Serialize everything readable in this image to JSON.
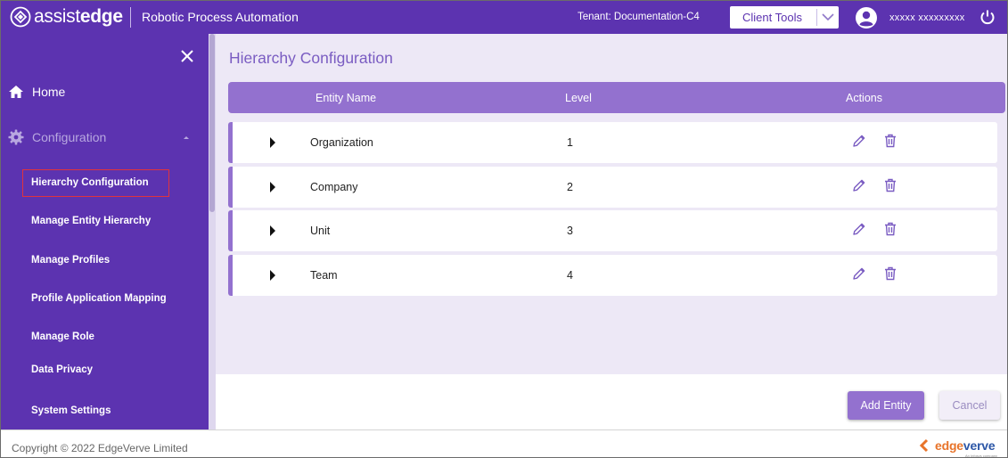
{
  "header": {
    "logo_light": "assist",
    "logo_bold": "edge",
    "app_title": "Robotic Process Automation",
    "tenant": "Tenant: Documentation-C4",
    "client_tools_label": "Client Tools",
    "user_name": "xxxxx xxxxxxxxx"
  },
  "sidebar": {
    "home_label": "Home",
    "configuration_label": "Configuration",
    "sub_items": [
      "Hierarchy Configuration",
      "Manage Entity Hierarchy",
      "Manage Profiles",
      "Profile Application Mapping",
      "Manage Role",
      "Data Privacy",
      "System Settings"
    ],
    "active_item": "Hierarchy Configuration"
  },
  "main": {
    "page_title": "Hierarchy Configuration",
    "columns": [
      "Entity Name",
      "Level",
      "Actions"
    ],
    "rows": [
      {
        "name": "Organization",
        "level": "1"
      },
      {
        "name": "Company",
        "level": "2"
      },
      {
        "name": "Unit",
        "level": "3"
      },
      {
        "name": "Team",
        "level": "4"
      }
    ],
    "add_button": "Add Entity",
    "cancel_button": "Cancel"
  },
  "footer": {
    "copyright": "Copyright © 2022 EdgeVerve Limited",
    "brand_part1": "edge",
    "brand_part2": "verve",
    "brand_tagline": "An Infosys company"
  },
  "colors": {
    "header_purple": "#5c33b0",
    "accent_purple": "#9371cf",
    "title_purple": "#7a5cc2",
    "content_bg": "#ede8f6",
    "active_outline": "#e0333d"
  },
  "icons": [
    "close-icon",
    "home-icon",
    "gear-icon",
    "chevron-up-icon",
    "chevron-down-icon",
    "user-icon",
    "power-icon",
    "caret-right-icon",
    "edit-icon",
    "delete-icon"
  ]
}
